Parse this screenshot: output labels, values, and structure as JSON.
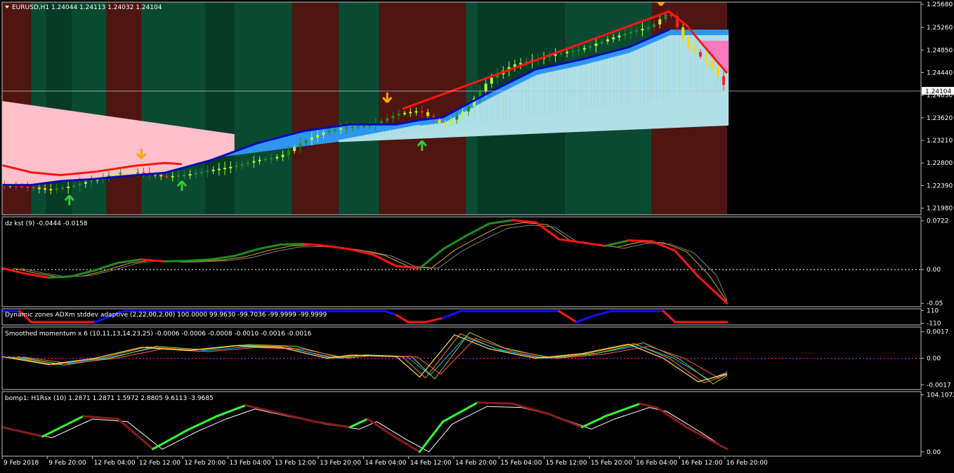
{
  "window": {
    "main_title": "EURUSD,H1  1.24044 1.24113 1.24032 1.24104",
    "current_price": "1.24104"
  },
  "colors": {
    "background": "#000000",
    "panel_border": "#c0c0c0",
    "bull_zone": "#0a4a30",
    "bear_zone": "#5a1a14",
    "pink_cloud": "#ffc0cb",
    "blue_cloud": "#2e96f0",
    "lightblue_cloud": "#b0e0e6",
    "red_line": "#ff1414",
    "green_line": "#228b22",
    "navy_line": "#0a0ab4",
    "orange_arrow": "#ffa500",
    "green_arrow": "#32cd32"
  },
  "chart_data": [
    {
      "type": "candlestick",
      "title": "EURUSD,H1  1.24044 1.24113 1.24032 1.24104",
      "ylim": [
        1.2186,
        1.2572
      ],
      "y_ticks": [
        "1.25680",
        "1.25260",
        "1.24850",
        "1.24440",
        "1.24030",
        "1.23620",
        "1.23210",
        "1.22800",
        "1.22390",
        "1.21980"
      ],
      "x_ticks": [
        "9 Feb 2018",
        "9 Feb 20:00",
        "12 Feb 04:00",
        "12 Feb 12:00",
        "12 Feb 20:00",
        "13 Feb 04:00",
        "13 Feb 12:00",
        "13 Feb 20:00",
        "14 Feb 04:00",
        "14 Feb 12:00",
        "14 Feb 20:00",
        "15 Feb 04:00",
        "15 Feb 12:00",
        "15 Feb 20:00",
        "16 Feb 04:00",
        "16 Feb 12:00",
        "16 Feb 20:00"
      ],
      "current_price": 1.24104,
      "close_path": [
        [
          0,
          1.224
        ],
        [
          20,
          1.2237
        ],
        [
          40,
          1.2232
        ],
        [
          60,
          1.2238
        ],
        [
          80,
          1.225
        ],
        [
          100,
          1.2262
        ],
        [
          120,
          1.2263
        ],
        [
          140,
          1.2255
        ],
        [
          160,
          1.2259
        ],
        [
          180,
          1.2267
        ],
        [
          200,
          1.2274
        ],
        [
          220,
          1.2285
        ],
        [
          240,
          1.2292
        ],
        [
          260,
          1.232
        ],
        [
          280,
          1.2338
        ],
        [
          300,
          1.2346
        ],
        [
          320,
          1.2349
        ],
        [
          340,
          1.2369
        ],
        [
          360,
          1.2375
        ],
        [
          380,
          1.2348
        ],
        [
          400,
          1.2378
        ],
        [
          420,
          1.2432
        ],
        [
          440,
          1.2458
        ],
        [
          460,
          1.2468
        ],
        [
          480,
          1.2479
        ],
        [
          500,
          1.2487
        ],
        [
          520,
          1.2503
        ],
        [
          540,
          1.2517
        ],
        [
          560,
          1.2528
        ],
        [
          575,
          1.2555
        ],
        [
          590,
          1.2493
        ],
        [
          610,
          1.246
        ],
        [
          625,
          1.2412
        ]
      ],
      "band_path": [
        [
          0,
          1.224
        ],
        [
          25,
          1.224
        ],
        [
          50,
          1.2247
        ],
        [
          80,
          1.2251
        ],
        [
          100,
          1.2255
        ],
        [
          140,
          1.2262
        ],
        [
          180,
          1.2285
        ],
        [
          220,
          1.2316
        ],
        [
          260,
          1.2338
        ],
        [
          300,
          1.235
        ],
        [
          340,
          1.235
        ],
        [
          360,
          1.2358
        ],
        [
          380,
          1.2363
        ],
        [
          420,
          1.2408
        ],
        [
          460,
          1.245
        ],
        [
          500,
          1.2468
        ],
        [
          540,
          1.249
        ],
        [
          575,
          1.2522
        ]
      ],
      "red_path": [
        [
          0,
          1.2276
        ],
        [
          25,
          1.2263
        ],
        [
          50,
          1.2258
        ],
        [
          80,
          1.2264
        ],
        [
          115,
          1.2275
        ],
        [
          140,
          1.228
        ],
        [
          155,
          1.2278
        ],
        [
          330,
          1.2381
        ],
        [
          345,
          1.2378
        ],
        [
          575,
          1.2555
        ],
        [
          590,
          1.253
        ],
        [
          610,
          1.248
        ],
        [
          625,
          1.2443
        ]
      ],
      "up_arrows": [
        [
          58,
          1.2221
        ],
        [
          155,
          1.2247
        ],
        [
          362,
          1.232
        ]
      ],
      "down_arrows": [
        [
          120,
          1.2288
        ],
        [
          332,
          1.239
        ],
        [
          568,
          1.2566
        ]
      ]
    },
    {
      "type": "line",
      "title": "dz kst (9) -0.0444 -0.0158",
      "ylim": [
        -0.055,
        0.078
      ],
      "y_ticks": [
        "0.0722",
        "0.00",
        "-0.05"
      ],
      "levels": [
        0
      ],
      "series": [
        {
          "values": [
            [
              0,
              0.002
            ],
            [
              20,
              -0.006
            ],
            [
              40,
              -0.012
            ],
            [
              60,
              -0.01
            ],
            [
              80,
              -0.001
            ],
            [
              100,
              0.01
            ],
            [
              120,
              0.015
            ],
            [
              140,
              0.012
            ],
            [
              160,
              0.013
            ],
            [
              180,
              0.015
            ],
            [
              200,
              0.02
            ],
            [
              220,
              0.03
            ],
            [
              240,
              0.037
            ],
            [
              260,
              0.038
            ],
            [
              280,
              0.035
            ],
            [
              300,
              0.03
            ],
            [
              320,
              0.022
            ],
            [
              340,
              0.005
            ],
            [
              360,
              0.002
            ],
            [
              380,
              0.03
            ],
            [
              400,
              0.05
            ],
            [
              420,
              0.068
            ],
            [
              440,
              0.073
            ],
            [
              460,
              0.07
            ],
            [
              480,
              0.045
            ],
            [
              500,
              0.04
            ],
            [
              520,
              0.035
            ],
            [
              540,
              0.043
            ],
            [
              560,
              0.042
            ],
            [
              580,
              0.028
            ],
            [
              600,
              -0.01
            ],
            [
              625,
              -0.05
            ]
          ]
        }
      ]
    },
    {
      "type": "line",
      "title": "Dynamic zones ADXm stddev adaptive (2,22,00,2.00) 100.0000 99.9630 -99.7036 -99.9999 -99.9999",
      "ylim": [
        -115,
        115
      ],
      "y_ticks": [
        "110",
        "-110"
      ],
      "series": [
        {
          "values": [
            [
              0,
              100
            ],
            [
              15,
              100
            ],
            [
              25,
              -90
            ],
            [
              60,
              -90
            ],
            [
              80,
              -90
            ],
            [
              105,
              100
            ],
            [
              140,
              100
            ],
            [
              200,
              100
            ],
            [
              300,
              100
            ],
            [
              330,
              100
            ],
            [
              340,
              30
            ],
            [
              350,
              -90
            ],
            [
              365,
              -90
            ],
            [
              380,
              -20
            ],
            [
              395,
              100
            ],
            [
              480,
              100
            ],
            [
              495,
              -90
            ],
            [
              510,
              20
            ],
            [
              525,
              100
            ],
            [
              570,
              100
            ],
            [
              580,
              -90
            ],
            [
              625,
              -90
            ]
          ]
        }
      ]
    },
    {
      "type": "line",
      "title": "Smoothed momentum x 6 (10,11,13,14,23,25) -0.0006 -0.0006 -0.0008 -0.0010 -0.0016 -0.0016",
      "ylim": [
        -0.002,
        0.002
      ],
      "y_ticks": [
        "0.0017",
        "0.00",
        "-0.0017"
      ],
      "levels": [
        0
      ],
      "series": [
        {
          "values": [
            [
              0,
              0.0001
            ],
            [
              40,
              -0.0004
            ],
            [
              80,
              0.0
            ],
            [
              120,
              0.0007
            ],
            [
              160,
              0.0005
            ],
            [
              200,
              0.0008
            ],
            [
              240,
              0.0007
            ],
            [
              280,
              0.0
            ],
            [
              300,
              0.0002
            ],
            [
              340,
              0.0001
            ],
            [
              360,
              -0.0012
            ],
            [
              390,
              0.0015
            ],
            [
              420,
              0.0006
            ],
            [
              460,
              0.0
            ],
            [
              500,
              0.0003
            ],
            [
              540,
              0.0009
            ],
            [
              570,
              0.0
            ],
            [
              600,
              -0.0015
            ],
            [
              625,
              -0.001
            ]
          ]
        }
      ]
    },
    {
      "type": "line",
      "title": "bomp1: H1Rsx (10) 1.2871 1.2871 1.5972 2.8805 9.6113 -3.9685",
      "ylim": [
        -8,
        110
      ],
      "y_ticks": [
        "104.1072",
        "0.00"
      ],
      "series": [
        {
          "values": [
            [
              0,
              45
            ],
            [
              35,
              28
            ],
            [
              70,
              65
            ],
            [
              100,
              60
            ],
            [
              130,
              5
            ],
            [
              160,
              40
            ],
            [
              185,
              65
            ],
            [
              210,
              85
            ],
            [
              240,
              70
            ],
            [
              270,
              55
            ],
            [
              300,
              45
            ],
            [
              315,
              60
            ],
            [
              340,
              25
            ],
            [
              360,
              0
            ],
            [
              380,
              55
            ],
            [
              410,
              90
            ],
            [
              440,
              88
            ],
            [
              470,
              70
            ],
            [
              500,
              45
            ],
            [
              520,
              65
            ],
            [
              550,
              88
            ],
            [
              565,
              80
            ],
            [
              590,
              45
            ],
            [
              625,
              5
            ]
          ]
        }
      ]
    }
  ]
}
